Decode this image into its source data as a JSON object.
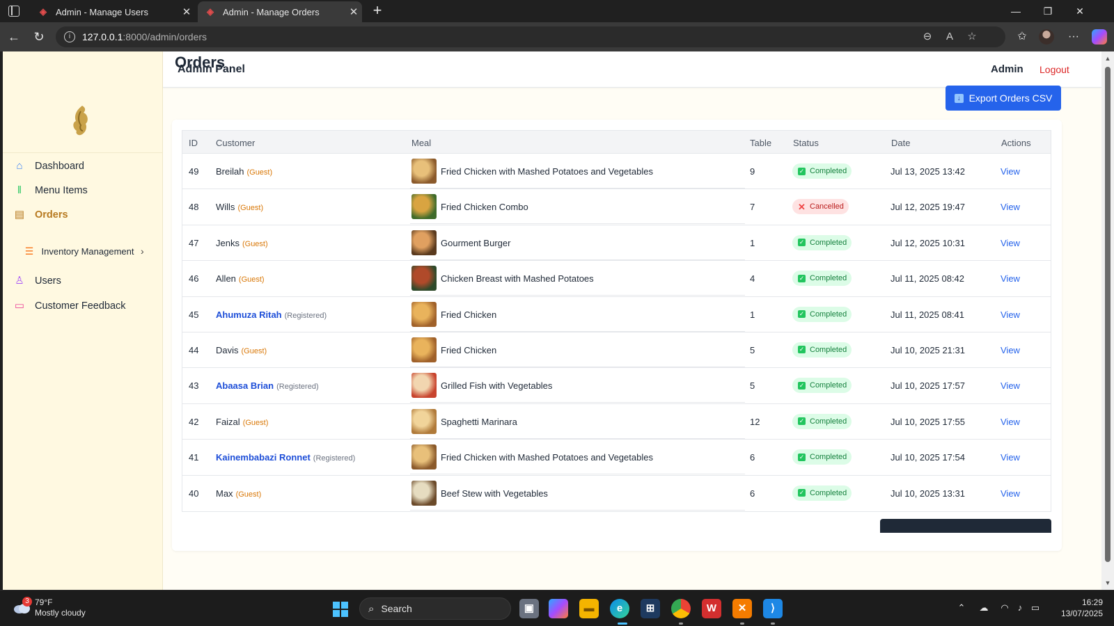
{
  "browser": {
    "tabs": [
      {
        "title": "Admin - Manage Users",
        "active": false
      },
      {
        "title": "Admin - Manage Orders",
        "active": true
      }
    ],
    "url_host": "127.0.0.1",
    "url_path": ":8000/admin/orders"
  },
  "sidebar": {
    "items": [
      {
        "label": "Dashboard",
        "icon": "home-icon",
        "color": "#3b82f6"
      },
      {
        "label": "Menu Items",
        "icon": "utensils-icon",
        "color": "#22c55e"
      },
      {
        "label": "Orders",
        "icon": "clipboard-icon",
        "color": "#b7791f",
        "active": true
      },
      {
        "label": "Inventory Management",
        "icon": "layers-icon",
        "color": "#f97316"
      },
      {
        "label": "Users",
        "icon": "user-icon",
        "color": "#a855f7"
      },
      {
        "label": "Customer Feedback",
        "icon": "message-icon",
        "color": "#ec4899"
      }
    ]
  },
  "topbar": {
    "brand": "Admin Panel",
    "user": "Admin",
    "logout": "Logout"
  },
  "page": {
    "title": "Orders",
    "export_label": "Export Orders CSV"
  },
  "table": {
    "headers": [
      "ID",
      "Customer",
      "Meal",
      "Table",
      "Status",
      "Date",
      "Actions"
    ],
    "rows": [
      {
        "id": "49",
        "customer": "Breilah",
        "type": "(Guest)",
        "registered": false,
        "meal": "Fried Chicken with Mashed Potatoes and Vegetables",
        "table": "9",
        "status": "Completed",
        "date": "Jul 13, 2025 13:42",
        "action": "View"
      },
      {
        "id": "48",
        "customer": "Wills",
        "type": "(Guest)",
        "registered": false,
        "meal": "Fried Chicken Combo",
        "table": "7",
        "status": "Cancelled",
        "date": "Jul 12, 2025 19:47",
        "action": "View"
      },
      {
        "id": "47",
        "customer": "Jenks",
        "type": "(Guest)",
        "registered": false,
        "meal": "Gourment Burger",
        "table": "1",
        "status": "Completed",
        "date": "Jul 12, 2025 10:31",
        "action": "View"
      },
      {
        "id": "46",
        "customer": "Allen",
        "type": "(Guest)",
        "registered": false,
        "meal": "Chicken Breast with Mashed Potatoes",
        "table": "4",
        "status": "Completed",
        "date": "Jul 11, 2025 08:42",
        "action": "View"
      },
      {
        "id": "45",
        "customer": "Ahumuza Ritah",
        "type": "(Registered)",
        "registered": true,
        "meal": "Fried Chicken",
        "table": "1",
        "status": "Completed",
        "date": "Jul 11, 2025 08:41",
        "action": "View"
      },
      {
        "id": "44",
        "customer": "Davis",
        "type": "(Guest)",
        "registered": false,
        "meal": "Fried Chicken",
        "table": "5",
        "status": "Completed",
        "date": "Jul 10, 2025 21:31",
        "action": "View"
      },
      {
        "id": "43",
        "customer": "Abaasa Brian",
        "type": "(Registered)",
        "registered": true,
        "meal": "Grilled Fish with Vegetables",
        "table": "5",
        "status": "Completed",
        "date": "Jul 10, 2025 17:57",
        "action": "View"
      },
      {
        "id": "42",
        "customer": "Faizal",
        "type": "(Guest)",
        "registered": false,
        "meal": "Spaghetti Marinara",
        "table": "12",
        "status": "Completed",
        "date": "Jul 10, 2025 17:55",
        "action": "View"
      },
      {
        "id": "41",
        "customer": "Kainembabazi Ronnet",
        "type": "(Registered)",
        "registered": true,
        "meal": "Fried Chicken with Mashed Potatoes and Vegetables",
        "table": "6",
        "status": "Completed",
        "date": "Jul 10, 2025 17:54",
        "action": "View"
      },
      {
        "id": "40",
        "customer": "Max",
        "type": "(Guest)",
        "registered": false,
        "meal": "Beef Stew with Vegetables",
        "table": "6",
        "status": "Completed",
        "date": "Jul 10, 2025 13:31",
        "action": "View"
      }
    ]
  },
  "taskbar": {
    "weather_temp": "79°F",
    "weather_desc": "Mostly cloudy",
    "weather_badge": "3",
    "search_label": "Search",
    "time": "16:29",
    "date": "13/07/2025"
  },
  "colors": {
    "accent": "#2563eb",
    "sidebar_bg": "#fff9e1",
    "completed": "#15803d",
    "cancelled": "#b91c1c"
  }
}
